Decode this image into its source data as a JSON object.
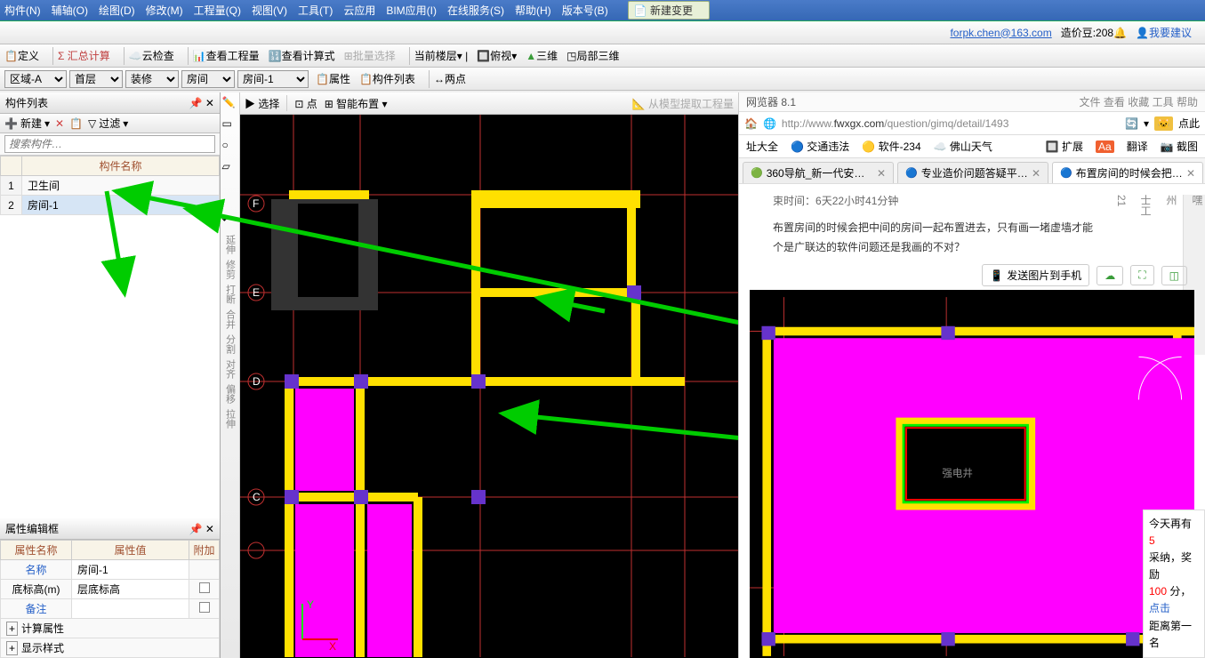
{
  "menubar": [
    "构件(N)",
    "辅轴(O)",
    "绘图(D)",
    "修改(M)",
    "工程量(Q)",
    "视图(V)",
    "工具(T)",
    "云应用",
    "BIM应用(I)",
    "在线服务(S)",
    "帮助(H)",
    "版本号(B)"
  ],
  "menubar_btn": "新建变更",
  "toolbar1": {
    "define": "定义",
    "sum": "Σ 汇总计算",
    "cloud": "云检查",
    "view_qty": "查看工程量",
    "view_formula": "查看计算式",
    "batch_select": "批量选择",
    "current_floor": "当前楼层",
    "top_view": "俯视",
    "threeD": "三维",
    "local3d": "局部三维"
  },
  "status_right": {
    "email": "forpk.chen@163.com",
    "coin_label": "造价豆:",
    "coin_val": "208",
    "suggest": "我要建议"
  },
  "left": {
    "panel_title": "构件列表",
    "new": "新建",
    "filter": "过滤",
    "search_placeholder": "搜索构件…",
    "col_header": "构件名称",
    "rows": [
      {
        "n": "1",
        "name": "卫生间"
      },
      {
        "n": "2",
        "name": "房间-1"
      }
    ],
    "prop_title": "属性编辑框",
    "prop_cols": [
      "属性名称",
      "属性值",
      "附加"
    ],
    "prop_rows": [
      {
        "k": "名称",
        "v": "房间-1",
        "cb": ""
      },
      {
        "k": "底标高(m)",
        "v": "层底标高",
        "cb": ""
      },
      {
        "k": "备注",
        "v": "",
        "cb": ""
      }
    ],
    "prop_expanders": [
      "计算属性",
      "显示样式"
    ]
  },
  "canvas_top": {
    "area": "区域-A",
    "floor": "首层",
    "category": "装修",
    "type": "房间",
    "item": "房间-1",
    "prop_btn": "属性",
    "list_btn": "构件列表",
    "two_points": "两点"
  },
  "canvas_sub": {
    "select": "选择",
    "point": "点",
    "smart": "智能布置",
    "extract": "从模型提取工程量"
  },
  "left_tools": [
    "延伸",
    "修剪",
    "打断",
    "合并",
    "分割",
    "对齐",
    "偏移",
    "拉伸"
  ],
  "browser": {
    "title_suffix": "网览器 8.1",
    "rt_icons": [
      "文件",
      "查看",
      "收藏",
      "工具",
      "帮助"
    ],
    "url_prefix": "http://www.",
    "url_host": "fwxgx.com",
    "url_path": "/question/gimq/detail/1493",
    "nav_right": "点此",
    "bookmarks": [
      "址大全",
      "交通违法",
      "软件-234",
      "佛山天气"
    ],
    "bk_right": [
      "扩展",
      "翻译",
      "截图"
    ],
    "tabs": [
      {
        "label": "360导航_新一代安全..."
      },
      {
        "label": "专业造价问题答疑平台..."
      },
      {
        "label": "布置房间的时候会把中..."
      }
    ],
    "time_label": "束时间：",
    "time_value": "6天22小时41分钟",
    "question_line1": "布置房间的时候会把中间的房间一起布置进去，只有画一堵虚墙才能",
    "question_line2": "个是广联达的软件问题还是我画的不对？",
    "send_phone": "发送图片到手机",
    "cad_label": "强电井",
    "side_tags": [
      "嘿",
      "州",
      "士工",
      "21"
    ],
    "reward": {
      "l1a": "今天再有 ",
      "l1b": "5",
      "l2": "采纳，奖励",
      "l3a": "100 ",
      "l3b": "分，",
      "l3c": "点击",
      "l4": "距离第一名"
    }
  }
}
